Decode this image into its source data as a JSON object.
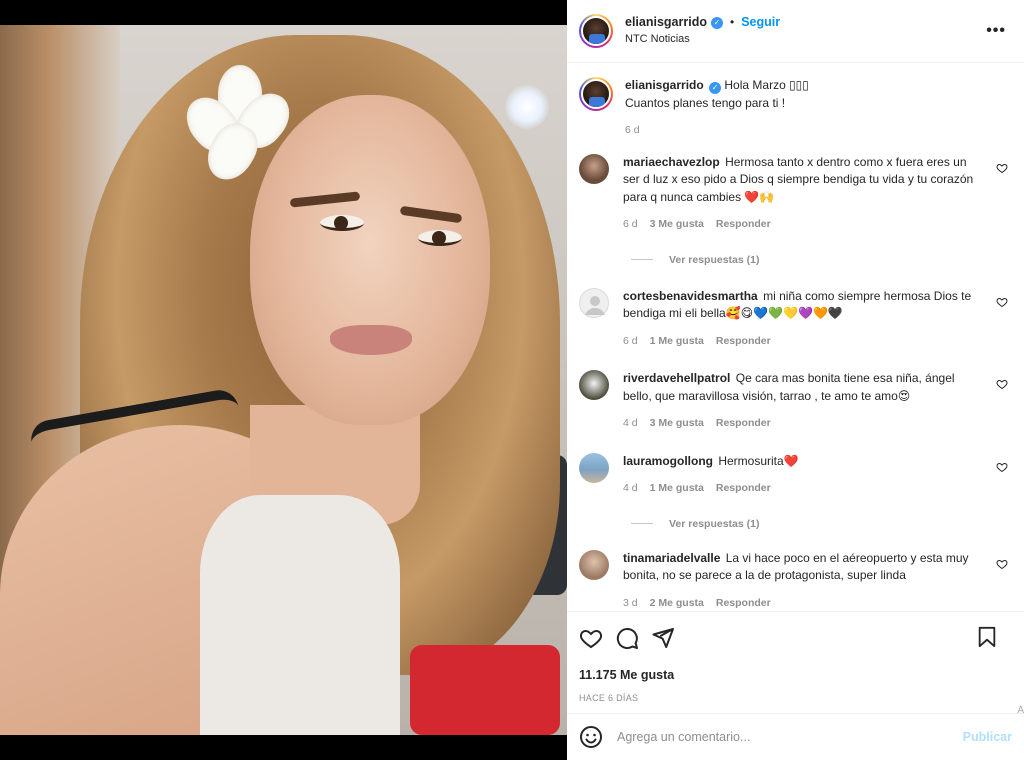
{
  "post": {
    "username": "elianisgarrido",
    "follow_label": "Seguir",
    "subtitle": "NTC Noticias",
    "caption_line1": "Hola Marzo ",
    "caption_emoji": "▯▯▯",
    "caption_line2": "Cuantos planes tengo para ti !",
    "caption_age": "6 d",
    "likes": "11.175 Me gusta",
    "date": "HACE 6 DÍAS"
  },
  "comments": [
    {
      "user": "mariaechavezlop",
      "text": "Hermosa tanto x dentro como x fuera eres un ser d luz x eso pido a Dios q siempre bendiga tu vida y tu corazón para q nunca cambies ❤️🙌",
      "age": "6 d",
      "likes": "3 Me gusta",
      "reply": "Responder",
      "avatar_color": "#6a4c3b",
      "view_replies": "Ver respuestas (1)"
    },
    {
      "user": "cortesbenavidesmartha",
      "text": "mi niña como siempre hermosa Dios te bendiga mi eli bella🥰😋💙💚💛💜🧡🖤",
      "age": "6 d",
      "likes": "1 Me gusta",
      "reply": "Responder",
      "avatar_color": "#dbdbdb",
      "view_replies": ""
    },
    {
      "user": "riverdavehellpatrol",
      "text": "Qe cara mas bonita tiene esa niña, ángel bello, que maravillosa visión, tarrao , te amo te amo😍",
      "age": "4 d",
      "likes": "3 Me gusta",
      "reply": "Responder",
      "avatar_color": "#4a4a3a",
      "view_replies": ""
    },
    {
      "user": "lauramogollong",
      "text": "Hermosurita❤️",
      "age": "4 d",
      "likes": "1 Me gusta",
      "reply": "Responder",
      "avatar_color": "#7da3c4",
      "view_replies": "Ver respuestas (1)"
    },
    {
      "user": "tinamariadelvalle",
      "text": "La vi hace poco en el aéreopuerto y esta muy bonita, no se parece a la de protagonista, super linda",
      "age": "3 d",
      "likes": "2 Me gusta",
      "reply": "Responder",
      "avatar_color": "#9c7b64",
      "view_replies": ""
    }
  ],
  "composer": {
    "placeholder": "Agrega un comentario...",
    "publish_label": "Publicar"
  },
  "icons": {
    "like": "heart-icon",
    "comment": "comment-icon",
    "share": "share-icon",
    "save": "bookmark-icon",
    "emoji": "emoji-icon",
    "more": "more-options-icon",
    "verified": "verified-badge-icon"
  },
  "colors": {
    "accent": "#0095f6",
    "verified": "#3897f0",
    "muted": "#8e8e8e",
    "publish_disabled": "#b2dffc"
  },
  "edge_glyph": "A"
}
